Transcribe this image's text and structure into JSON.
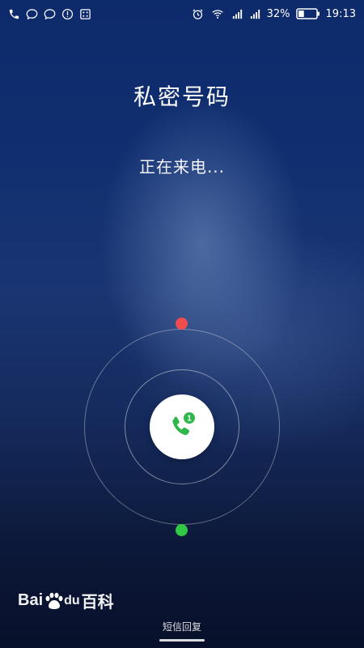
{
  "status_bar": {
    "left_icons": [
      "phone-icon",
      "chat-bubble-icon",
      "chat-bubble-icon",
      "alert-icon",
      "screenshot-icon"
    ],
    "right_icons": [
      "alarm-icon",
      "wifi-icon",
      "signal-icon",
      "signal-icon"
    ],
    "battery": "32%",
    "battery_level": 0.32,
    "time": "19:13"
  },
  "call": {
    "caller_name": "私密号码",
    "status": "正在来电..."
  },
  "slider": {
    "handle_icon": "phone-answer-icon",
    "badge": "1",
    "decline_color": "#ef4d4d",
    "accept_color": "#31c844"
  },
  "watermark": {
    "text_bai": "Bai",
    "text_du": "du",
    "text_baike": "百科"
  },
  "bottom": {
    "sms_reply": "短信回复"
  }
}
